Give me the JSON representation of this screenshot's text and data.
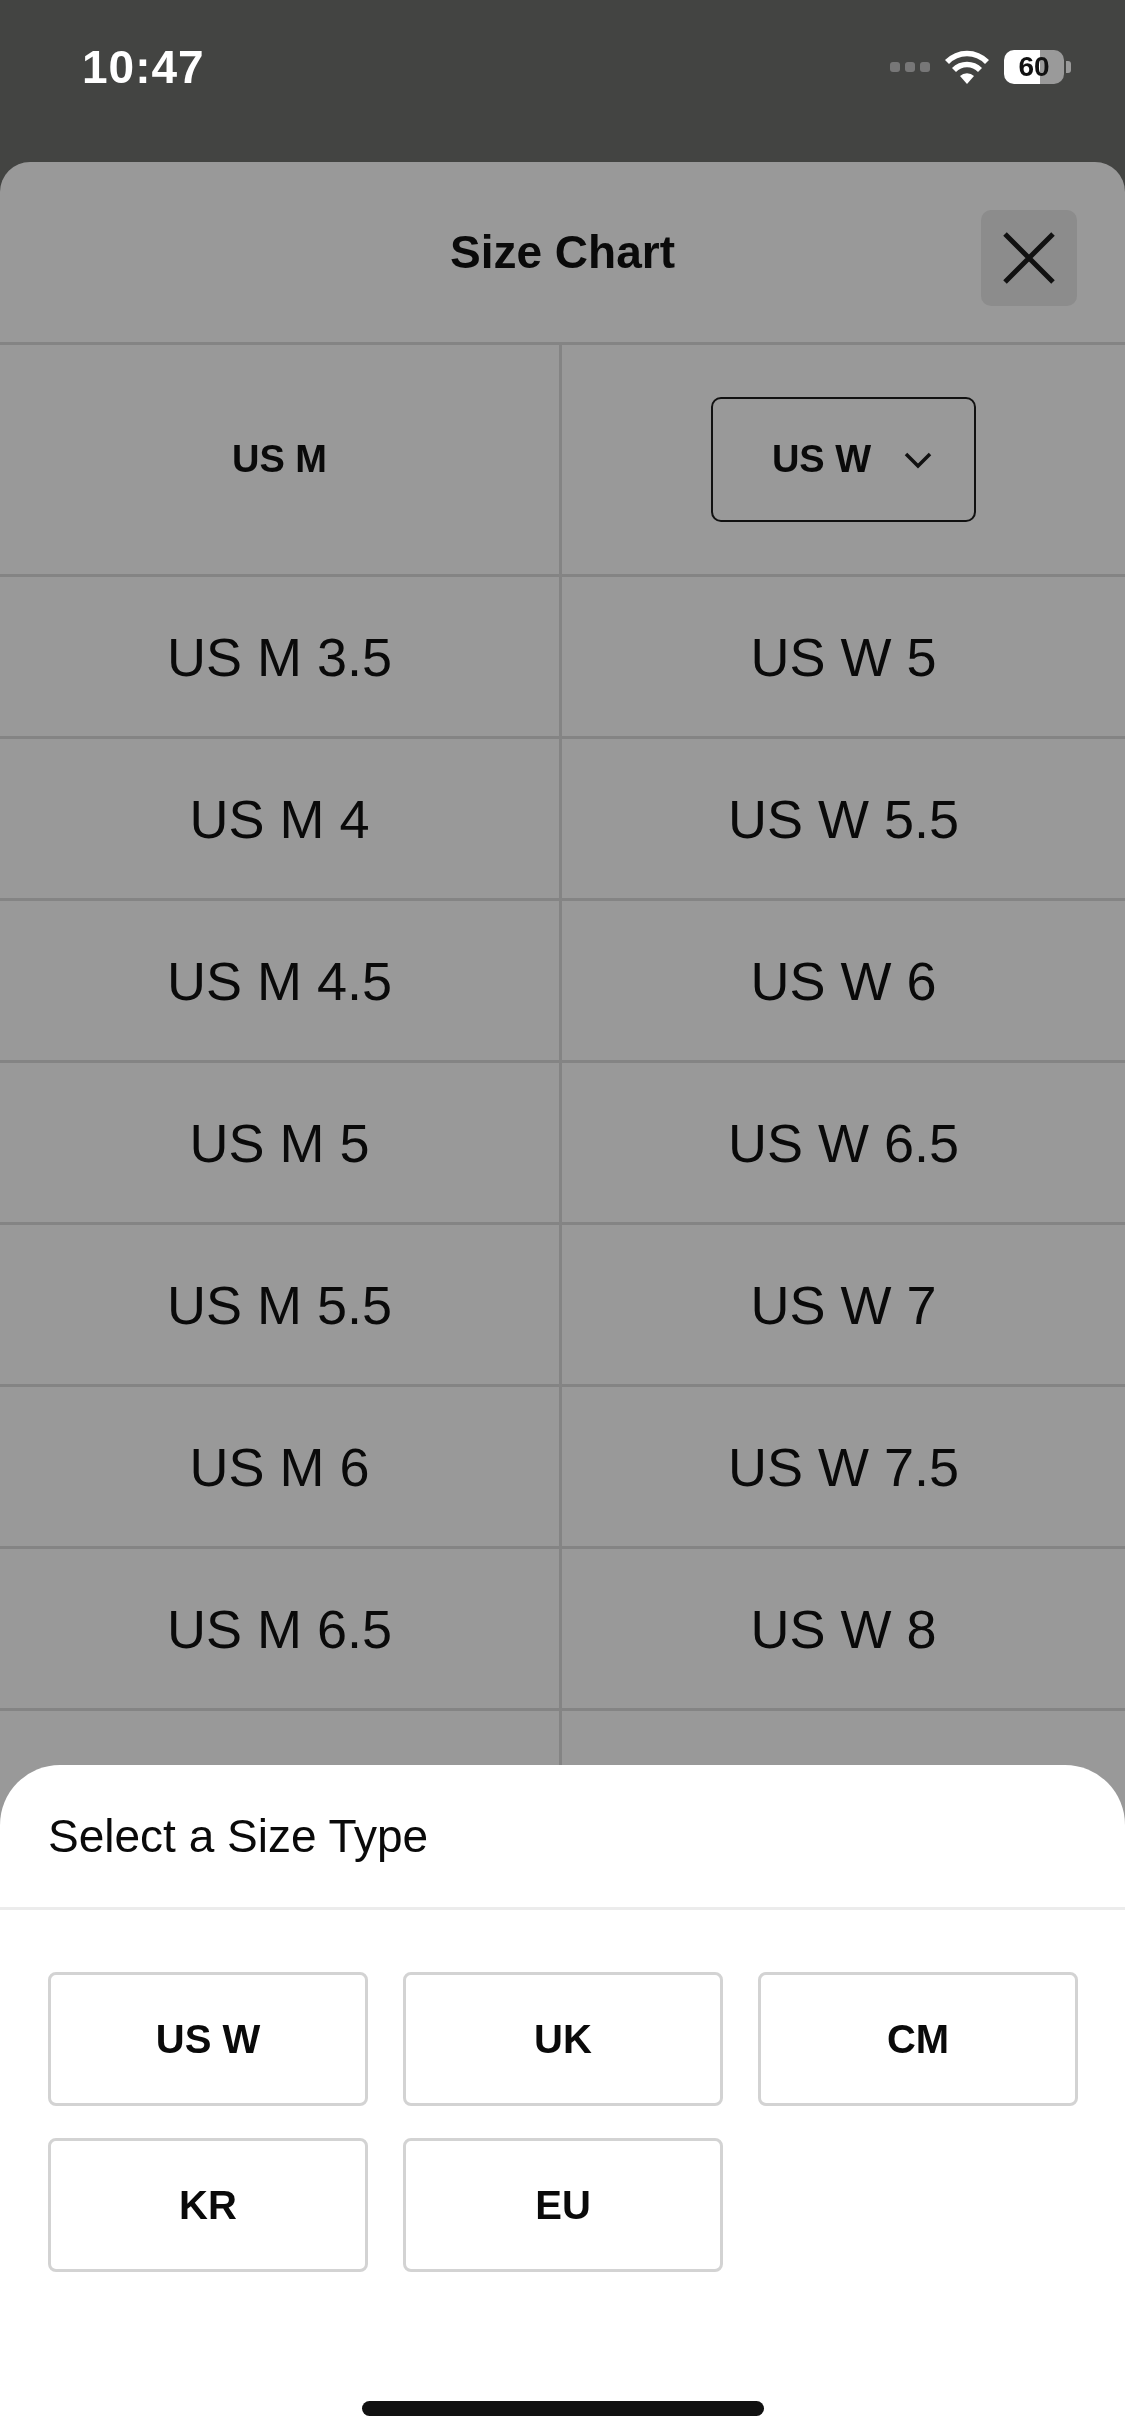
{
  "status_bar": {
    "time": "10:47",
    "battery": "60"
  },
  "size_chart": {
    "title": "Size Chart",
    "columns": [
      {
        "kind": "label",
        "label": "US M"
      },
      {
        "kind": "dropdown",
        "label": "US W"
      }
    ],
    "rows": [
      [
        "US M 3.5",
        "US W 5"
      ],
      [
        "US M 4",
        "US W 5.5"
      ],
      [
        "US M 4.5",
        "US W 6"
      ],
      [
        "US M 5",
        "US W 6.5"
      ],
      [
        "US M 5.5",
        "US W 7"
      ],
      [
        "US M 6",
        "US W 7.5"
      ],
      [
        "US M 6.5",
        "US W 8"
      ]
    ]
  },
  "size_type_sheet": {
    "title": "Select a Size Type",
    "options": [
      {
        "label": "US W",
        "selected": false
      },
      {
        "label": "UK",
        "selected": false
      },
      {
        "label": "CM",
        "selected": false
      },
      {
        "label": "KR",
        "selected": false
      },
      {
        "label": "EU",
        "selected": false
      }
    ]
  }
}
